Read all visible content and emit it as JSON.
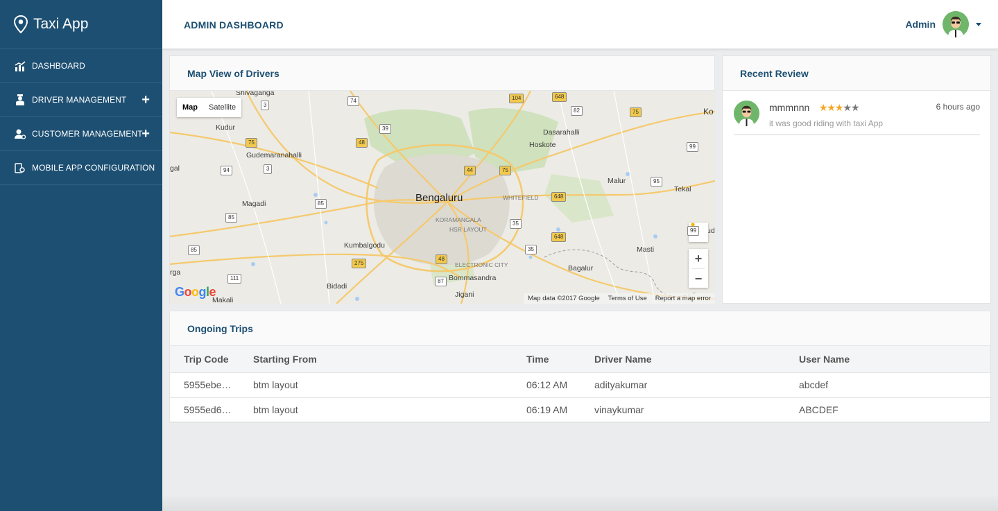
{
  "app": {
    "title": "Taxi App"
  },
  "sidebar": {
    "items": [
      {
        "label": "DASHBOARD",
        "icon": "chart-icon",
        "expandable": false
      },
      {
        "label": "DRIVER MANAGEMENT",
        "icon": "driver-icon",
        "expandable": true
      },
      {
        "label": "CUSTOMER MANAGEMENT",
        "icon": "customer-icon",
        "expandable": true
      },
      {
        "label": "MOBILE APP CONFIGURATION",
        "icon": "mobile-config-icon",
        "expandable": false
      }
    ]
  },
  "header": {
    "title": "ADMIN DASHBOARD",
    "user_name": "Admin"
  },
  "map_panel": {
    "title": "Map View of Drivers",
    "map_type": [
      "Map",
      "Satellite"
    ],
    "selected_type": "Map",
    "zoom_in": "+",
    "zoom_out": "−",
    "google": "Google",
    "attribution": [
      "Map data ©2017 Google",
      "Terms of Use",
      "Report a map error"
    ],
    "places": [
      "Shivaganga",
      "Kudur",
      "Gudemaranahalli",
      "Magadi",
      "Kumbalgodu",
      "Bidadi",
      "Makali",
      "Bengaluru",
      "WHITEFIELD",
      "KORAMANGALA",
      "HSR LAYOUT",
      "ELECTRONIC CITY",
      "Bommasandra",
      "Jigani",
      "Dasarahalli",
      "Hoskote",
      "Malur",
      "Tekal",
      "Masti",
      "Bagalur",
      "Ko",
      "gal",
      "rga",
      "ud"
    ],
    "highways": [
      "74",
      "3",
      "39",
      "48",
      "75",
      "94",
      "3",
      "85",
      "85",
      "85",
      "104",
      "648",
      "82",
      "75",
      "99",
      "44",
      "75",
      "648",
      "95",
      "35",
      "648",
      "35",
      "275",
      "48",
      "111",
      "87",
      "99"
    ]
  },
  "review_panel": {
    "title": "Recent Review",
    "reviews": [
      {
        "name": "mmmnnn",
        "rating": 3,
        "max_rating": 5,
        "comment": "it was good riding with taxi App",
        "time": "6 hours ago"
      }
    ]
  },
  "trips_panel": {
    "title": "Ongoing Trips",
    "columns": [
      "Trip Code",
      "Starting From",
      "Time",
      "Driver Name",
      "User Name"
    ],
    "rows": [
      [
        "5955ebe…",
        "btm layout",
        "06:12 AM",
        "adityakumar",
        "abcdef"
      ],
      [
        "5955ed6…",
        "btm layout",
        "06:19 AM",
        "vinaykumar",
        "ABCDEF"
      ]
    ]
  },
  "colors": {
    "sidebar": "#1d4f72",
    "accent": "#1d4f72",
    "star": "#f5a623",
    "highway_shield": "#f2c94c"
  }
}
